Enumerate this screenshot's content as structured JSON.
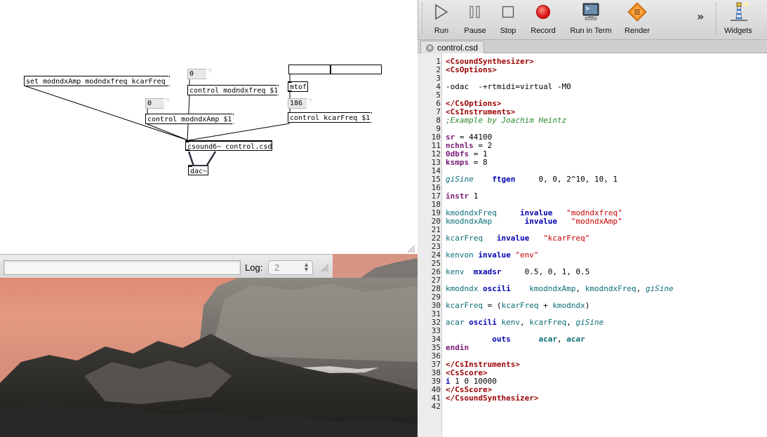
{
  "pd": {
    "message_set": "set modndxAmp modndxfreq kcarFreq",
    "num_modndxfreq": "0",
    "msg_control_modndxfreq": "control modndxfreq $1",
    "num_modndxAmp": "0",
    "msg_control_modndxAmp": "control modndxAmp $1",
    "hslider_value": 0.45,
    "obj_mtof": "mtof",
    "num_carfreq": "186",
    "msg_control_kcarFreq": "control kcarFreq $1",
    "obj_csound": "csound6~ control.csd",
    "obj_dac": "dac~"
  },
  "log": {
    "label": "Log:",
    "level": "2",
    "filter_value": ""
  },
  "toolbar": {
    "run": "Run",
    "pause": "Pause",
    "stop": "Stop",
    "record": "Record",
    "run_in_term": "Run in Term",
    "render": "Render",
    "overflow": "»",
    "widgets": "Widgets"
  },
  "tab": {
    "title": "control.csd"
  },
  "code": [
    {
      "n": "1",
      "seg": [
        [
          "<CsoundSynthesizer>",
          "t-tag"
        ]
      ]
    },
    {
      "n": "2",
      "seg": [
        [
          "<CsOptions>",
          "t-tag"
        ]
      ]
    },
    {
      "n": "3",
      "seg": []
    },
    {
      "n": "4",
      "seg": [
        [
          "-odac  -+rtmidi=virtual -M0",
          "t-plain"
        ]
      ]
    },
    {
      "n": "5",
      "seg": []
    },
    {
      "n": "6",
      "seg": [
        [
          "</CsOptions>",
          "t-tag"
        ]
      ]
    },
    {
      "n": "7",
      "seg": [
        [
          "<CsInstruments>",
          "t-tag"
        ]
      ]
    },
    {
      "n": "8",
      "seg": [
        [
          ";Example by Joachim Heintz",
          "t-cmt"
        ]
      ]
    },
    {
      "n": "9",
      "seg": []
    },
    {
      "n": "10",
      "seg": [
        [
          "sr",
          "t-ctl"
        ],
        [
          " = 44100",
          "t-plain"
        ]
      ]
    },
    {
      "n": "11",
      "seg": [
        [
          "nchnls",
          "t-ctl"
        ],
        [
          " = 2",
          "t-plain"
        ]
      ]
    },
    {
      "n": "12",
      "seg": [
        [
          "0dbfs",
          "t-ctl"
        ],
        [
          " = 1",
          "t-plain"
        ]
      ]
    },
    {
      "n": "13",
      "seg": [
        [
          "ksmps",
          "t-ctl"
        ],
        [
          " = 8",
          "t-plain"
        ]
      ]
    },
    {
      "n": "14",
      "seg": []
    },
    {
      "n": "15",
      "seg": [
        [
          "giSine",
          "t-gvar"
        ],
        [
          "    ",
          "t-plain"
        ],
        [
          "ftgen",
          "t-kw"
        ],
        [
          "     0, 0, 2^10, 10, 1",
          "t-plain"
        ]
      ]
    },
    {
      "n": "16",
      "seg": []
    },
    {
      "n": "17",
      "seg": [
        [
          "instr",
          "t-ctl"
        ],
        [
          " 1",
          "t-plain"
        ]
      ]
    },
    {
      "n": "18",
      "seg": []
    },
    {
      "n": "19",
      "seg": [
        [
          "kmodndxFreq",
          "t-var"
        ],
        [
          "     ",
          "t-plain"
        ],
        [
          "invalue",
          "t-kw"
        ],
        [
          "   ",
          "t-plain"
        ],
        [
          "\"modndxfreq\"",
          "t-str"
        ]
      ]
    },
    {
      "n": "20",
      "seg": [
        [
          "kmodndxAmp",
          "t-var"
        ],
        [
          "       ",
          "t-plain"
        ],
        [
          "invalue",
          "t-kw"
        ],
        [
          "   ",
          "t-plain"
        ],
        [
          "\"modndxAmp\"",
          "t-str"
        ]
      ]
    },
    {
      "n": "21",
      "seg": []
    },
    {
      "n": "22",
      "seg": [
        [
          "kcarFreq",
          "t-var"
        ],
        [
          "   ",
          "t-plain"
        ],
        [
          "invalue",
          "t-kw"
        ],
        [
          "   ",
          "t-plain"
        ],
        [
          "\"kcarFreq\"",
          "t-str"
        ]
      ]
    },
    {
      "n": "23",
      "seg": []
    },
    {
      "n": "24",
      "seg": [
        [
          "kenvon",
          "t-var"
        ],
        [
          " ",
          "t-plain"
        ],
        [
          "invalue",
          "t-kw"
        ],
        [
          " ",
          "t-plain"
        ],
        [
          "\"env\"",
          "t-str"
        ]
      ]
    },
    {
      "n": "25",
      "seg": []
    },
    {
      "n": "26",
      "seg": [
        [
          "kenv",
          "t-var"
        ],
        [
          "  ",
          "t-plain"
        ],
        [
          "mxadsr",
          "t-kw"
        ],
        [
          "     0.5, 0, 1, 0.5",
          "t-plain"
        ]
      ]
    },
    {
      "n": "27",
      "seg": []
    },
    {
      "n": "28",
      "seg": [
        [
          "kmodndx",
          "t-var"
        ],
        [
          " ",
          "t-plain"
        ],
        [
          "oscili",
          "t-kw"
        ],
        [
          "    ",
          "t-plain"
        ],
        [
          "kmodndxAmp",
          "t-var"
        ],
        [
          ", ",
          "t-plain"
        ],
        [
          "kmodndxFreq",
          "t-var"
        ],
        [
          ", ",
          "t-plain"
        ],
        [
          "giSine",
          "t-gvar"
        ]
      ]
    },
    {
      "n": "29",
      "seg": []
    },
    {
      "n": "30",
      "seg": [
        [
          "kcarFreq",
          "t-var"
        ],
        [
          " = (",
          "t-plain"
        ],
        [
          "kcarFreq",
          "t-var"
        ],
        [
          " + ",
          "t-plain"
        ],
        [
          "kmodndx",
          "t-var"
        ],
        [
          ")",
          "t-plain"
        ]
      ]
    },
    {
      "n": "31",
      "seg": []
    },
    {
      "n": "32",
      "seg": [
        [
          "acar",
          "t-var"
        ],
        [
          " ",
          "t-plain"
        ],
        [
          "oscili",
          "t-kw"
        ],
        [
          " ",
          "t-plain"
        ],
        [
          "kenv",
          "t-var"
        ],
        [
          ", ",
          "t-plain"
        ],
        [
          "kcarFreq",
          "t-var"
        ],
        [
          ", ",
          "t-plain"
        ],
        [
          "giSine",
          "t-gvar"
        ]
      ]
    },
    {
      "n": "33",
      "seg": []
    },
    {
      "n": "34",
      "seg": [
        [
          "          ",
          "t-plain"
        ],
        [
          "outs",
          "t-kw"
        ],
        [
          "      ",
          "t-plain"
        ],
        [
          "acar",
          "t-op"
        ],
        [
          ", ",
          "t-plain"
        ],
        [
          "acar",
          "t-op"
        ]
      ]
    },
    {
      "n": "35",
      "seg": [
        [
          "endin",
          "t-ctl"
        ]
      ]
    },
    {
      "n": "36",
      "seg": []
    },
    {
      "n": "37",
      "seg": [
        [
          "</CsInstruments>",
          "t-tag"
        ]
      ]
    },
    {
      "n": "38",
      "seg": [
        [
          "<CsScore>",
          "t-tag"
        ]
      ]
    },
    {
      "n": "39",
      "seg": [
        [
          "i",
          "t-kw"
        ],
        [
          " 1 0 10000",
          "t-plain"
        ]
      ]
    },
    {
      "n": "40",
      "seg": [
        [
          "</CsScore>",
          "t-tag"
        ]
      ]
    },
    {
      "n": "41",
      "seg": [
        [
          "</CsoundSynthesizer>",
          "t-tag"
        ]
      ]
    },
    {
      "n": "42",
      "seg": []
    }
  ],
  "icons": {
    "run": "play-triangle-icon",
    "pause": "pause-bars-icon",
    "stop": "stop-square-icon",
    "record": "record-red-circle-icon",
    "run_in_term": "terminal-monitor-icon",
    "render": "render-diamond-icon",
    "widgets": "widgets-lighthouse-icon",
    "tab_close": "close-circle-icon"
  },
  "colors": {
    "record_red": "#e3191c",
    "render_orange": "#f08a1c",
    "tag": "#9b0000",
    "keyword": "#0000b0",
    "variable": "#0b6e78",
    "string": "#c40000",
    "comment": "#2c8a2c"
  }
}
